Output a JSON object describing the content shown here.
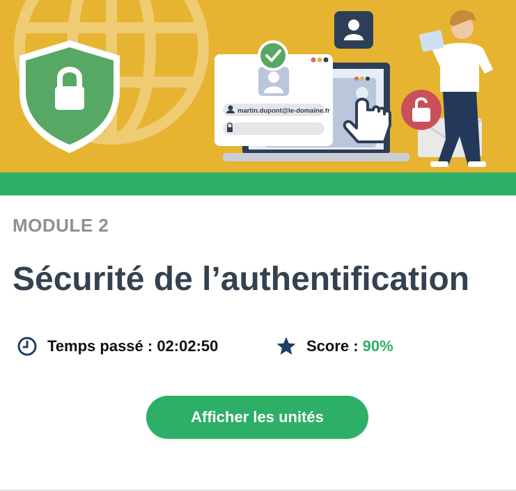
{
  "banner": {
    "email_field_value": "martin.dupont@le-domaine.fr"
  },
  "module": {
    "label": "MODULE 2",
    "title": "Sécurité de l’authentification",
    "progress_fraction": 1.0
  },
  "stats": {
    "time_label": "Temps passé : 02:02:50",
    "score_label": "Score :",
    "score_value": "90%"
  },
  "actions": {
    "show_units_label": "Afficher les unités"
  },
  "icons": {
    "time": "clock-icon",
    "score": "star-icon"
  },
  "colors": {
    "banner_background": "#e6b431",
    "accent_green": "#2eaf67",
    "title_text": "#334150",
    "module_label_text": "#8f8f8f",
    "icon_navy": "#1e3f66"
  }
}
